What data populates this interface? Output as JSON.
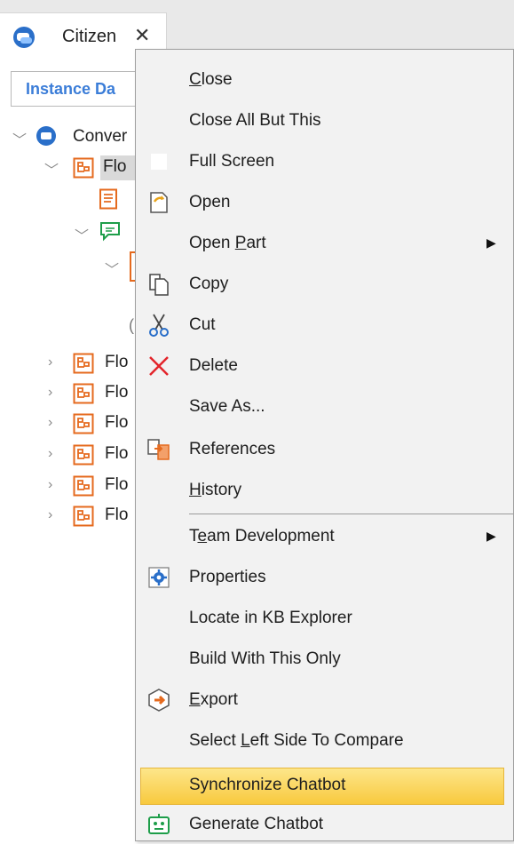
{
  "tab": {
    "title": "Citizen",
    "close_glyph": "✕",
    "icon": "chatbot-app-icon"
  },
  "instance_box": {
    "label": "Instance Da"
  },
  "tree": {
    "root_label": "Conver",
    "selected_flow_label": "Flo",
    "flows": [
      "Flo",
      "Flo",
      "Flo",
      "Flo",
      "Flo",
      "Flo"
    ]
  },
  "menu": {
    "items": [
      {
        "pre": "",
        "u": "C",
        "post": "lose",
        "icon": ""
      },
      {
        "pre": "Close All But This",
        "u": "",
        "post": "",
        "icon": ""
      },
      {
        "pre": "Full Screen",
        "u": "",
        "post": "",
        "icon": "full-screen-icon"
      },
      {
        "pre": "Open",
        "u": "",
        "post": "",
        "icon": "open-icon"
      },
      {
        "pre": "Open ",
        "u": "P",
        "post": "art",
        "icon": "",
        "submenu": true
      },
      {
        "pre": "Copy",
        "u": "",
        "post": "",
        "icon": "copy-icon"
      },
      {
        "pre": "Cut",
        "u": "",
        "post": "",
        "icon": "cut-icon"
      },
      {
        "pre": "Delete",
        "u": "",
        "post": "",
        "icon": "delete-icon"
      },
      {
        "pre": "Save As...",
        "u": "",
        "post": "",
        "icon": ""
      },
      {
        "pre": "References",
        "u": "",
        "post": "",
        "icon": "references-icon"
      },
      {
        "pre": "",
        "u": "H",
        "post": "istory",
        "icon": ""
      },
      {
        "pre": "T",
        "u": "e",
        "post": "am Development",
        "icon": "",
        "submenu": true
      },
      {
        "pre": "Properties",
        "u": "",
        "post": "",
        "icon": "properties-icon"
      },
      {
        "pre": "Locate in KB Explorer",
        "u": "",
        "post": "",
        "icon": ""
      },
      {
        "pre": "Build With This Only",
        "u": "",
        "post": "",
        "icon": ""
      },
      {
        "pre": "",
        "u": "E",
        "post": "xport",
        "icon": "export-icon"
      },
      {
        "pre": "Select ",
        "u": "L",
        "post": "eft Side To Compare",
        "icon": ""
      },
      {
        "pre": "Synchronize Chatbot",
        "u": "",
        "post": "",
        "icon": "",
        "highlighted": true
      },
      {
        "pre": "Generate Chatbot",
        "u": "",
        "post": "",
        "icon": "generate-chatbot-icon"
      }
    ],
    "submenu_arrow": "▶",
    "highlight_color": "#f8c93e"
  }
}
